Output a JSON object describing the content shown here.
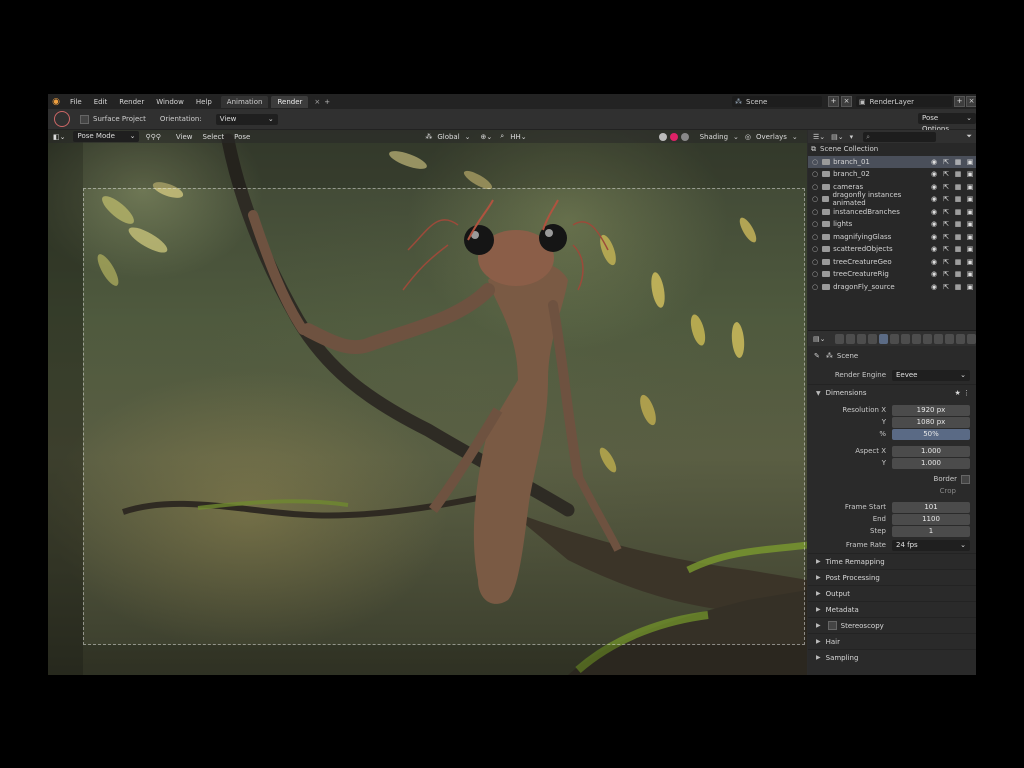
{
  "topbar": {
    "menus": [
      "File",
      "Edit",
      "Render",
      "Window",
      "Help"
    ],
    "tabs": [
      {
        "label": "Animation",
        "active": false
      },
      {
        "label": "Render",
        "active": true
      }
    ],
    "close_tab": "×",
    "add_tab": "+",
    "scene_name": "Scene",
    "render_layer": "RenderLayer"
  },
  "tool_header": {
    "surface_project": "Surface Project",
    "orientation_label": "Orientation:",
    "orientation_value": "View",
    "pose_options": "Pose Options"
  },
  "viewport_header": {
    "mode": "Pose Mode",
    "menus": [
      "View",
      "Select",
      "Pose"
    ],
    "transform": "Global",
    "shading": "Shading",
    "overlays": "Overlays"
  },
  "outliner": {
    "collection": "Scene Collection",
    "items": [
      {
        "name": "branch_01",
        "selected": true
      },
      {
        "name": "branch_02",
        "selected": false
      },
      {
        "name": "cameras",
        "selected": false
      },
      {
        "name": "dragonfly instances animated",
        "selected": false
      },
      {
        "name": "instancedBranches",
        "selected": false
      },
      {
        "name": "lights",
        "selected": false
      },
      {
        "name": "magnifyingGlass",
        "selected": false
      },
      {
        "name": "scatteredObjects",
        "selected": false
      },
      {
        "name": "treeCreatureGeo",
        "selected": false
      },
      {
        "name": "treeCreatureRig",
        "selected": false
      },
      {
        "name": "dragonFly_source",
        "selected": false
      }
    ]
  },
  "properties": {
    "scene_label": "Scene",
    "render_engine_label": "Render Engine",
    "render_engine_value": "Eevee",
    "dimensions": "Dimensions",
    "resolution_x_label": "Resolution X",
    "resolution_x": "1920 px",
    "y_label": "Y",
    "resolution_y": "1080 px",
    "pct_label": "%",
    "pct": "50%",
    "aspect_x_label": "Aspect X",
    "aspect_x": "1.000",
    "aspect_y": "1.000",
    "border": "Border",
    "crop": "Crop",
    "frame_start_label": "Frame Start",
    "frame_start": "101",
    "end_label": "End",
    "frame_end": "1100",
    "step_label": "Step",
    "step": "1",
    "frame_rate_label": "Frame Rate",
    "frame_rate": "24 fps",
    "sections": [
      "Time Remapping",
      "Post Processing",
      "Output",
      "Metadata",
      "Stereoscopy",
      "Hair",
      "Sampling"
    ]
  }
}
